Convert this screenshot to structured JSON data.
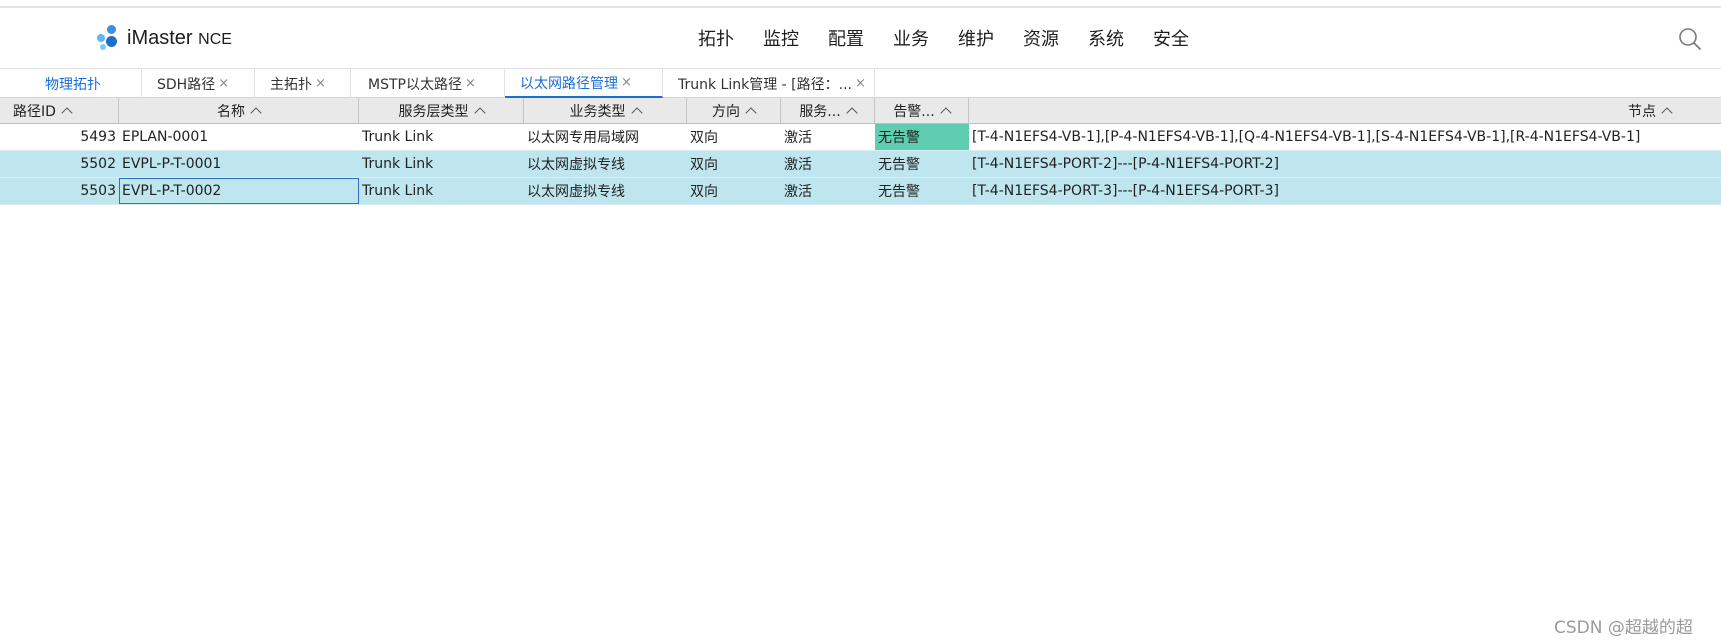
{
  "app": {
    "logo_main": "iMaster",
    "logo_sub": "NCE"
  },
  "nav": [
    "拓扑",
    "监控",
    "配置",
    "业务",
    "维护",
    "资源",
    "系统",
    "安全"
  ],
  "tabs": [
    {
      "label": "物理拓扑",
      "closable": false
    },
    {
      "label": "SDH路径",
      "closable": true
    },
    {
      "label": "主拓扑",
      "closable": true
    },
    {
      "label": "MSTP以太路径",
      "closable": true
    },
    {
      "label": "以太网路径管理",
      "closable": true
    },
    {
      "label": "Trunk Link管理 - [路径：...",
      "closable": true
    }
  ],
  "tab_close_glyph": "×",
  "active_tab": "以太网路径管理",
  "table": {
    "columns": [
      "路径ID",
      "名称",
      "服务层类型",
      "业务类型",
      "方向",
      "服务...",
      "告警...",
      "节点"
    ],
    "rows": [
      [
        "5493",
        "EPLAN-0001",
        "Trunk Link",
        "以太网专用局域网",
        "双向",
        "激活",
        "无告警",
        "[T-4-N1EFS4-VB-1],[P-4-N1EFS4-VB-1],[Q-4-N1EFS4-VB-1],[S-4-N1EFS4-VB-1],[R-4-N1EFS4-VB-1]"
      ],
      [
        "5502",
        "EVPL-P-T-0001",
        "Trunk Link",
        "以太网虚拟专线",
        "双向",
        "激活",
        "无告警",
        "[T-4-N1EFS4-PORT-2]---[P-4-N1EFS4-PORT-2]"
      ],
      [
        "5503",
        "EVPL-P-T-0002",
        "Trunk Link",
        "以太网虚拟专线",
        "双向",
        "激活",
        "无告警",
        "[T-4-N1EFS4-PORT-3]---[P-4-N1EFS4-PORT-3]"
      ]
    ],
    "selected_rows": [
      1,
      2
    ]
  },
  "colors": {
    "accent": "#1a6ed8",
    "selected_row": "#bfe6ef",
    "alarm_none": "#5fcdb0"
  },
  "icons": {
    "search": "search-icon",
    "sort": "chevron-up-icon",
    "close": "close-icon"
  },
  "watermark": "CSDN @超越的超"
}
